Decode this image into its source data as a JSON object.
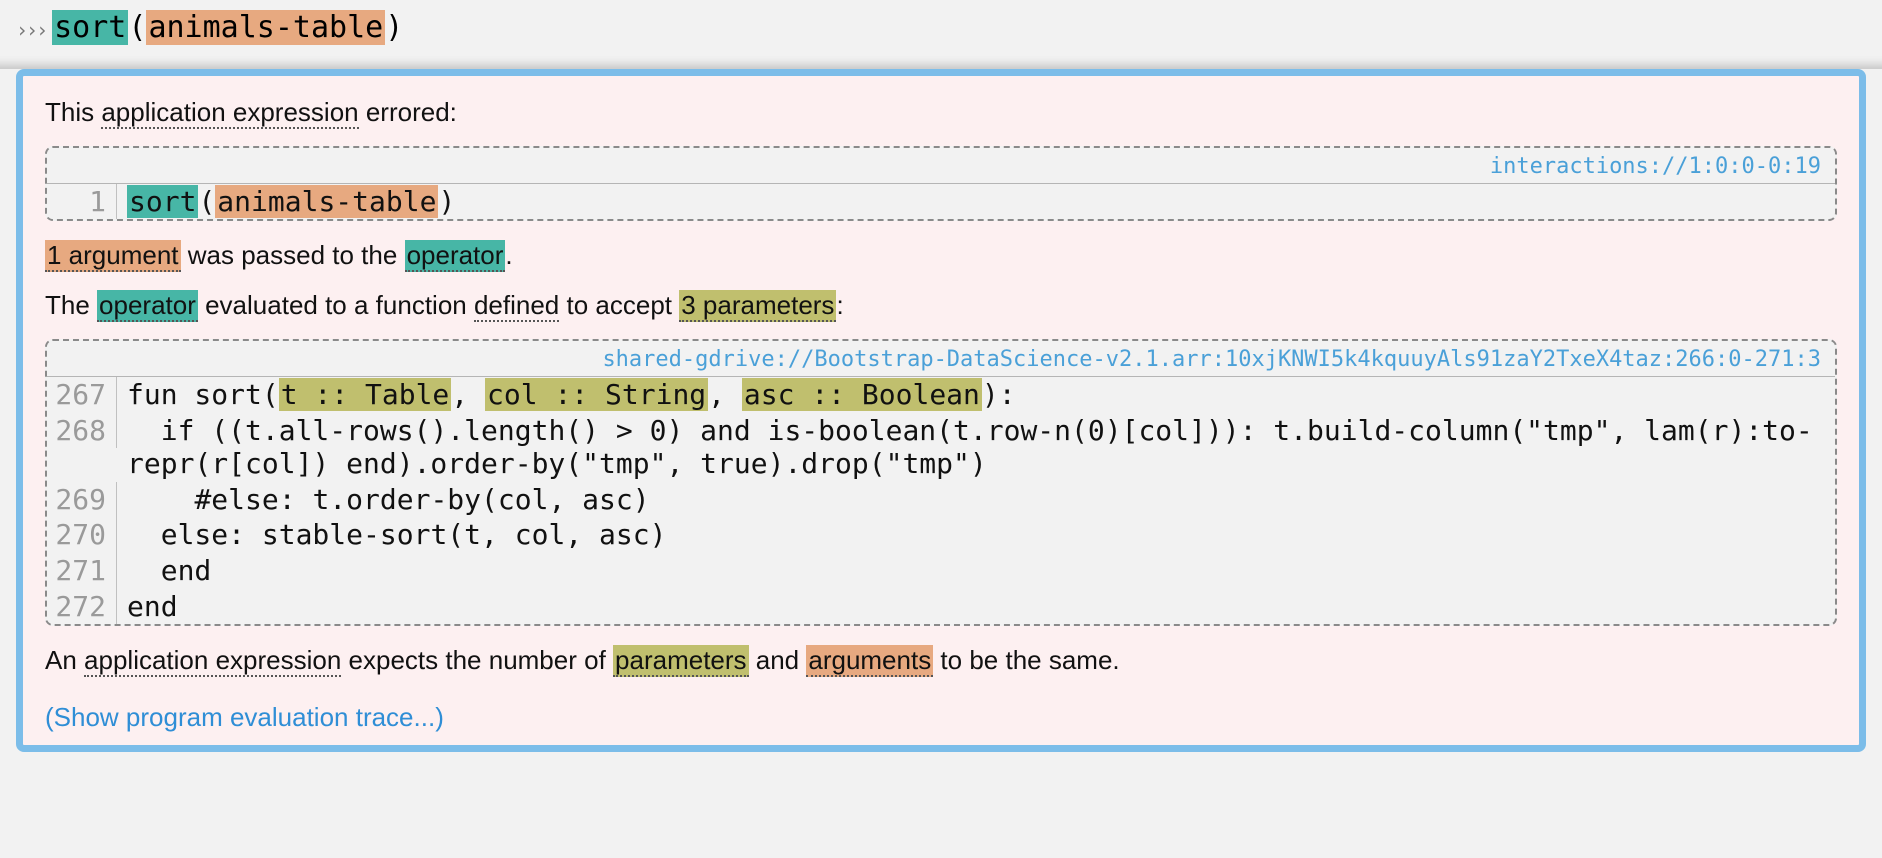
{
  "repl": {
    "prompt": "›››",
    "call_fn": "sort",
    "lparen": "(",
    "arg": "animals-table",
    "rparen": ")"
  },
  "err": {
    "line1_a": "This ",
    "line1_b": "application expression",
    "line1_c": " errored:",
    "block1": {
      "src": "interactions://1:0:0-0:19",
      "row1": {
        "num": "1",
        "fn": "sort",
        "lparen": "(",
        "arg": "animals-table",
        "rparen": ")"
      }
    },
    "line2_a": "1 argument",
    "line2_b": " was passed to the ",
    "line2_c": "operator",
    "line2_d": ".",
    "line3_a": "The ",
    "line3_b": "operator",
    "line3_c": " evaluated to a function ",
    "line3_d": "defined",
    "line3_e": " to accept ",
    "line3_f": "3 parameters",
    "line3_g": ":",
    "block2": {
      "src": "shared-gdrive://Bootstrap-DataScience-v2.1.arr:10xjKNWI5k4kquuyAls91zaY2TxeX4taz:266:0-271:3",
      "r267": {
        "num": "267",
        "a": "fun sort(",
        "p1": "t :: Table",
        "s1": ", ",
        "p2": "col :: String",
        "s2": ", ",
        "p3": "asc :: Boolean",
        "b": "):"
      },
      "r268": {
        "num": "268",
        "code": "  if ((t.all-rows().length() > 0) and is-boolean(t.row-n(0)[col])): t.build-column(\"tmp\", lam(r):to-repr(r[col]) end).order-by(\"tmp\", true).drop(\"tmp\")"
      },
      "r269": {
        "num": "269",
        "code": "    #else: t.order-by(col, asc)"
      },
      "r270": {
        "num": "270",
        "code": "  else: stable-sort(t, col, asc)"
      },
      "r271": {
        "num": "271",
        "code": "  end"
      },
      "r272": {
        "num": "272",
        "code": "end"
      }
    },
    "line4_a": "An ",
    "line4_b": "application expression",
    "line4_c": " expects the number of ",
    "line4_d": "parameters",
    "line4_e": " and ",
    "line4_f": "arguments",
    "line4_g": " to be the same.",
    "trace": "(Show program evaluation trace...)"
  }
}
